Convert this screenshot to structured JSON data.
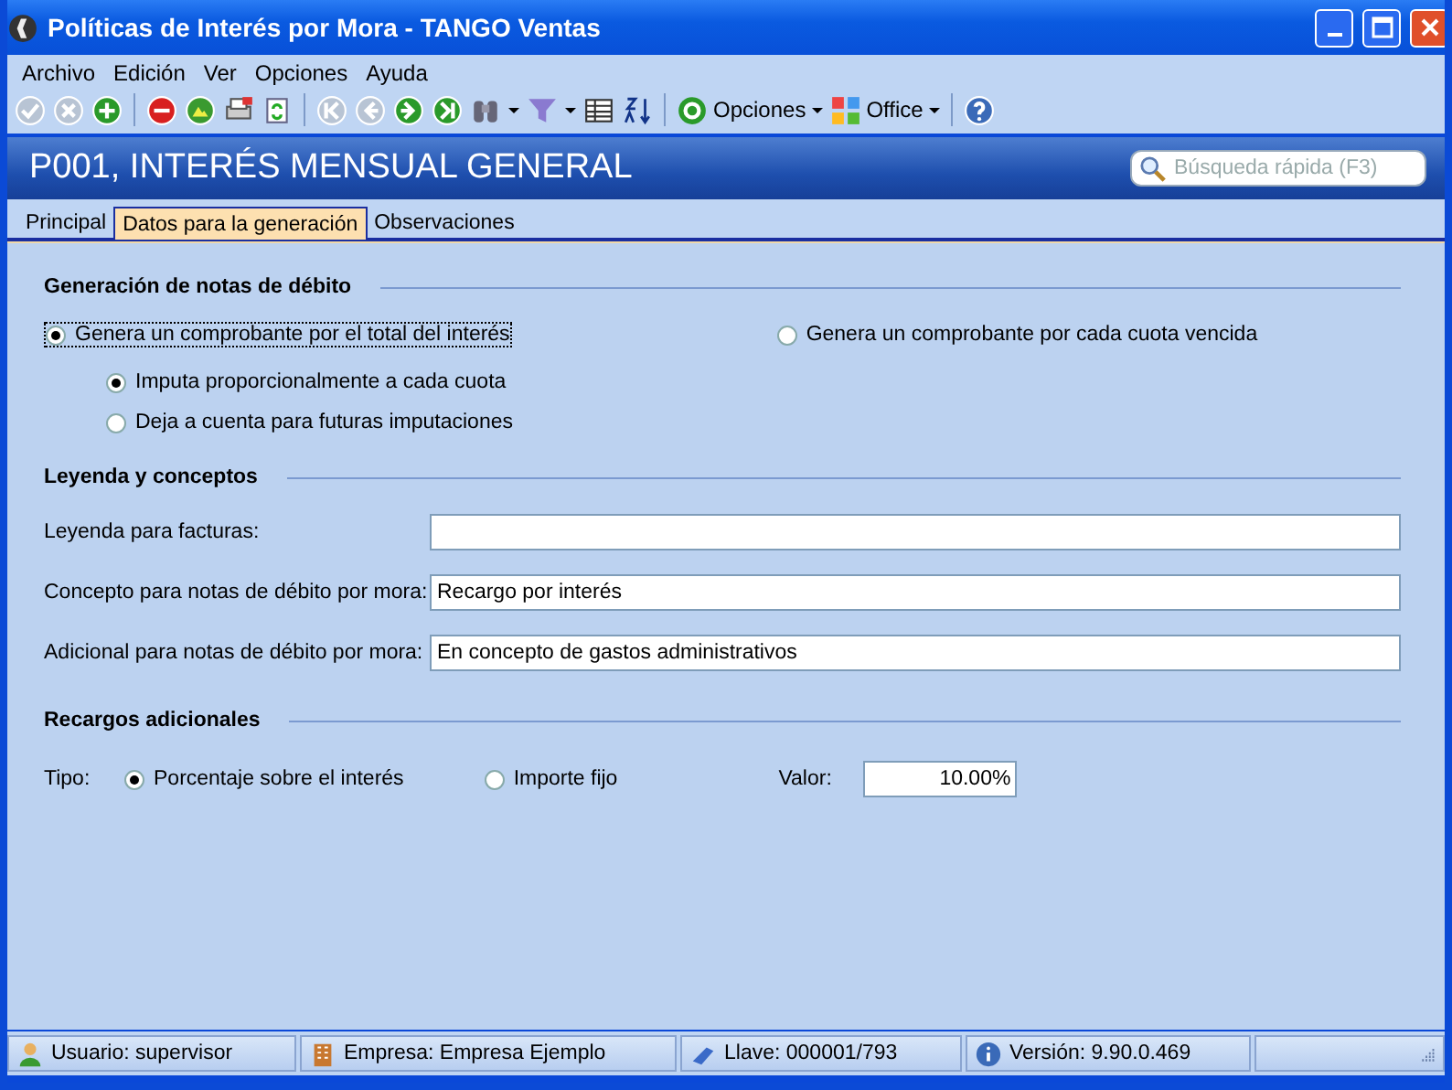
{
  "window": {
    "title": "Políticas de Interés por Mora - TANGO Ventas"
  },
  "menu": [
    "Archivo",
    "Edición",
    "Ver",
    "Opciones",
    "Ayuda"
  ],
  "toolbar": [
    {
      "kind": "icon",
      "disabled": true
    },
    {
      "kind": "icon",
      "disabled": true
    },
    {
      "kind": "icon",
      "disabled": false
    },
    {
      "kind": "separator"
    },
    {
      "kind": "icon",
      "disabled": false
    },
    {
      "kind": "icon",
      "disabled": false
    },
    {
      "kind": "icon",
      "disabled": false
    },
    {
      "kind": "icon",
      "disabled": false
    },
    {
      "kind": "separator"
    },
    {
      "kind": "icon",
      "disabled": true
    },
    {
      "kind": "icon",
      "disabled": true
    },
    {
      "kind": "icon",
      "disabled": false
    },
    {
      "kind": "icon",
      "disabled": false
    },
    {
      "kind": "dropdown",
      "disabled": false
    },
    {
      "kind": "dropdown",
      "disabled": false
    },
    {
      "kind": "icon",
      "disabled": false
    },
    {
      "kind": "icon",
      "disabled": false
    },
    {
      "kind": "separator"
    },
    {
      "kind": "menu",
      "label": "Opciones"
    },
    {
      "kind": "menu",
      "label": "Office"
    },
    {
      "kind": "separator"
    },
    {
      "kind": "icon",
      "disabled": false
    }
  ],
  "header": {
    "title": "P001, INTERÉS MENSUAL GENERAL",
    "search": {
      "placeholder": "Búsqueda rápida (F3)"
    }
  },
  "tabs": [
    {
      "label": "Principal",
      "selected": false
    },
    {
      "label": "Datos para la generación",
      "selected": true
    },
    {
      "label": "Observaciones",
      "selected": false
    }
  ],
  "sections": [
    {
      "title": "Generación de notas de débito",
      "kind": "radios",
      "options": [
        {
          "label": "Genera un comprobante por el total del interés",
          "selected": true,
          "focused": true
        },
        {
          "label": "Genera un comprobante por cada cuota vencida",
          "selected": false,
          "focused": false
        }
      ],
      "sub_options": [
        {
          "label": "Imputa proporcionalmente a cada cuota",
          "selected": true
        },
        {
          "label": "Deja a cuenta para futuras imputaciones",
          "selected": false
        }
      ]
    },
    {
      "title": "Leyenda y conceptos",
      "kind": "fields",
      "fields": [
        {
          "label": "Leyenda para facturas:"
        },
        {
          "label": "Concepto para notas de débito por mora:",
          "value": "Recargo por interés"
        },
        {
          "label": "Adicional para notas de débito por mora:",
          "value": "En concepto de gastos administrativos"
        }
      ]
    },
    {
      "title": "Recargos adicionales",
      "kind": "type",
      "type_label": "Tipo:",
      "options": [
        {
          "label": "Porcentaje sobre el interés",
          "selected": true
        },
        {
          "label": "Importe fijo",
          "selected": false
        }
      ],
      "value_label": "Valor:",
      "value": "10.00%"
    }
  ],
  "status_bar": [
    {
      "text": "Usuario: supervisor"
    },
    {
      "text": "Empresa: Empresa Ejemplo"
    },
    {
      "text": "Llave: 000001/793"
    },
    {
      "text": "Versión: 9.90.0.469"
    }
  ]
}
